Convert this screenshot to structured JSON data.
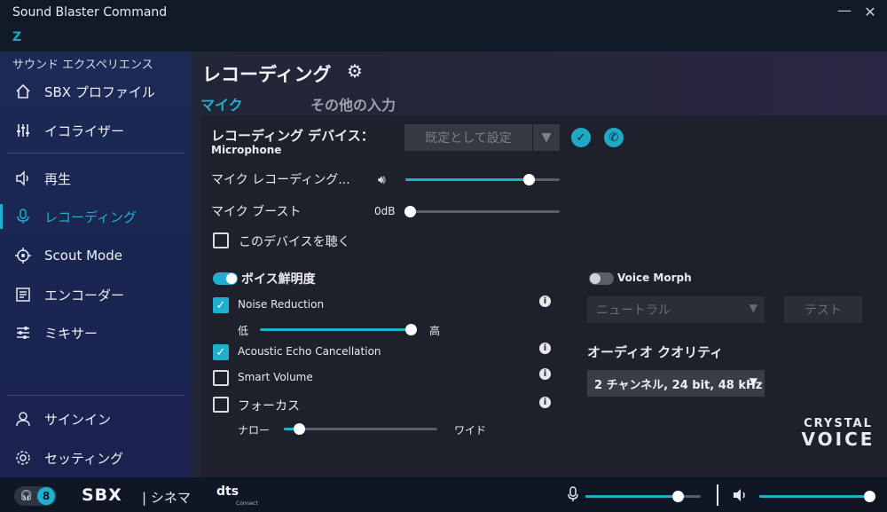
{
  "app": {
    "title": "Sound Blaster Command",
    "logo": "Z",
    "minimize_icon": "—",
    "close_icon": "✕"
  },
  "sidebar": {
    "section_label": "サウンド エクスペリエンス",
    "items": [
      {
        "label": "SBX プロファイル",
        "icon": "home-icon"
      },
      {
        "label": "イコライザー",
        "icon": "equalizer-icon"
      },
      {
        "label": "再生",
        "icon": "speaker-icon"
      },
      {
        "label": "レコーディング",
        "icon": "microphone-icon"
      },
      {
        "label": "Scout Mode",
        "icon": "crosshair-icon"
      },
      {
        "label": "エンコーダー",
        "icon": "encoder-icon"
      },
      {
        "label": "ミキサー",
        "icon": "mixer-icon"
      },
      {
        "label": "サインイン",
        "icon": "user-icon"
      },
      {
        "label": "セッティング",
        "icon": "gear-icon"
      }
    ]
  },
  "main": {
    "title": "レコーディング",
    "tabs": [
      {
        "label": "マイク"
      },
      {
        "label": "その他の入力"
      }
    ],
    "device": {
      "label": "レコーディング デバイス：",
      "name": "Microphone",
      "set_default_label": "既定として設定"
    },
    "mic_level": {
      "label": "マイク レコーディング...",
      "value": 0.8
    },
    "mic_boost": {
      "label": "マイク ブースト",
      "value_text": "0dB",
      "value": 0.0
    },
    "listen_device": {
      "label": "このデバイスを聴く",
      "checked": false
    },
    "voice_clarity": {
      "label": "ボイス鮮明度",
      "enabled": true,
      "noise_reduction": {
        "label": "Noise Reduction",
        "checked": true,
        "low": "低",
        "high": "高",
        "value": 1.0
      },
      "echo_cancellation": {
        "label": "Acoustic Echo Cancellation",
        "checked": true
      },
      "smart_volume": {
        "label": "Smart Volume",
        "checked": false
      },
      "focus": {
        "label": "フォーカス",
        "checked": false,
        "narrow": "ナロー",
        "wide": "ワイド",
        "value": 0.1
      }
    },
    "voice_morph": {
      "label": "Voice Morph",
      "enabled": false,
      "preset": "ニュートラル",
      "test_label": "テスト"
    },
    "audio_quality": {
      "label": "オーディオ クオリティ",
      "value": "2 チャンネル, 24 bit, 48 kHz"
    },
    "brand": {
      "line1": "CRYSTAL",
      "line2": "VOICE"
    }
  },
  "footer": {
    "headset_badge": "8",
    "sbx_logo": "SBX",
    "sbx_mode": "| シネマ",
    "dts_logo": "dts",
    "dts_sub": "Connect",
    "mic_volume": 0.8,
    "speaker_volume": 1.0
  },
  "colors": {
    "accent": "#1fb0cf",
    "sidebar": "#1d2a55",
    "panel": "#1e212c"
  }
}
